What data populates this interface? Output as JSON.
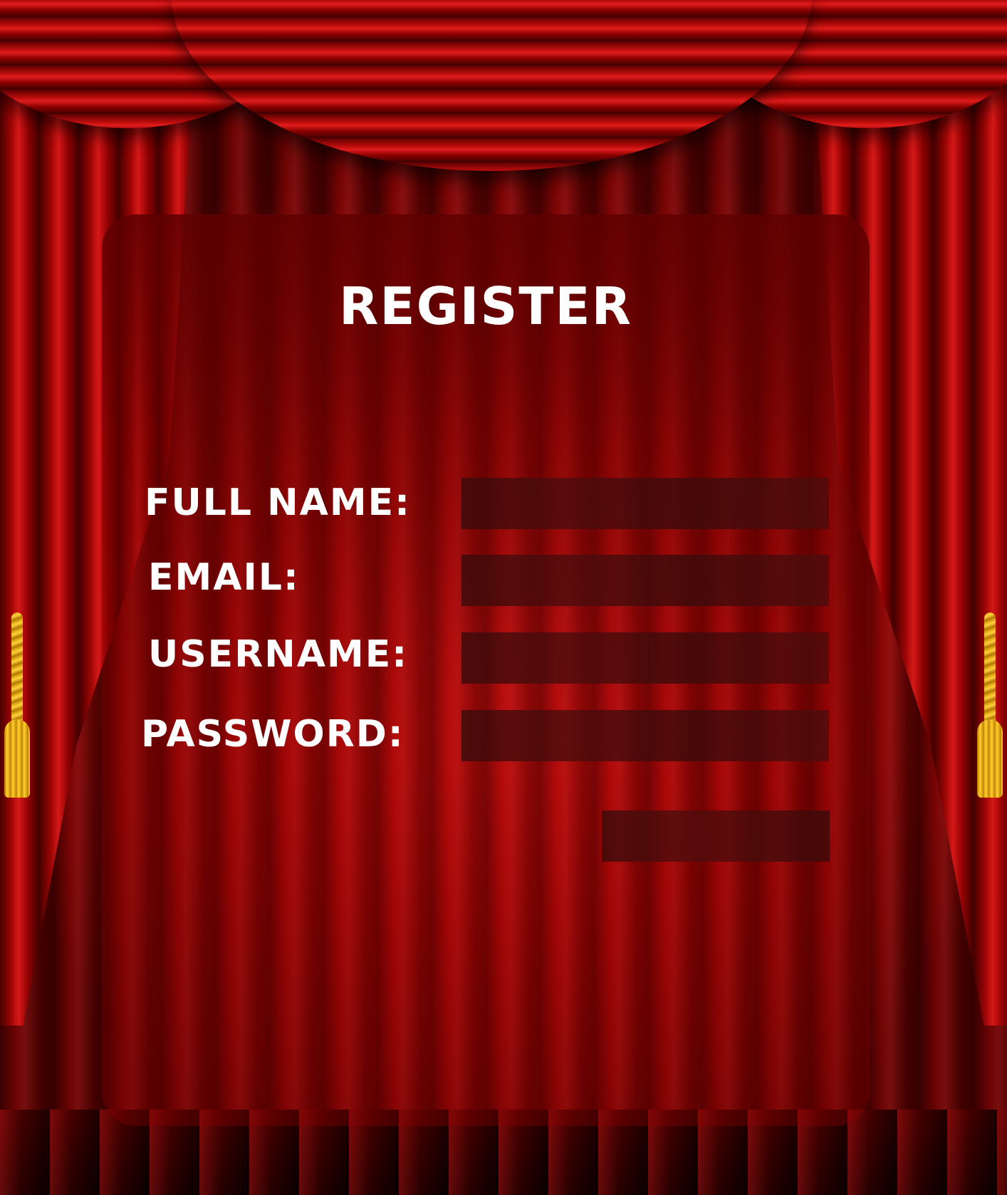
{
  "form": {
    "title": "REGISTER",
    "fields": [
      {
        "label": "FULL NAME:",
        "value": "",
        "placeholder": ""
      },
      {
        "label": "EMAIL:",
        "value": "",
        "placeholder": ""
      },
      {
        "label": "USERNAME:",
        "value": "",
        "placeholder": ""
      },
      {
        "label": "PASSWORD:",
        "value": "",
        "placeholder": ""
      }
    ],
    "submit_label": ""
  },
  "theme": {
    "accent": "#b00a0a",
    "text": "#ffffff",
    "input_bg": "#4a0c0c",
    "tassel": "#f2b51c"
  }
}
